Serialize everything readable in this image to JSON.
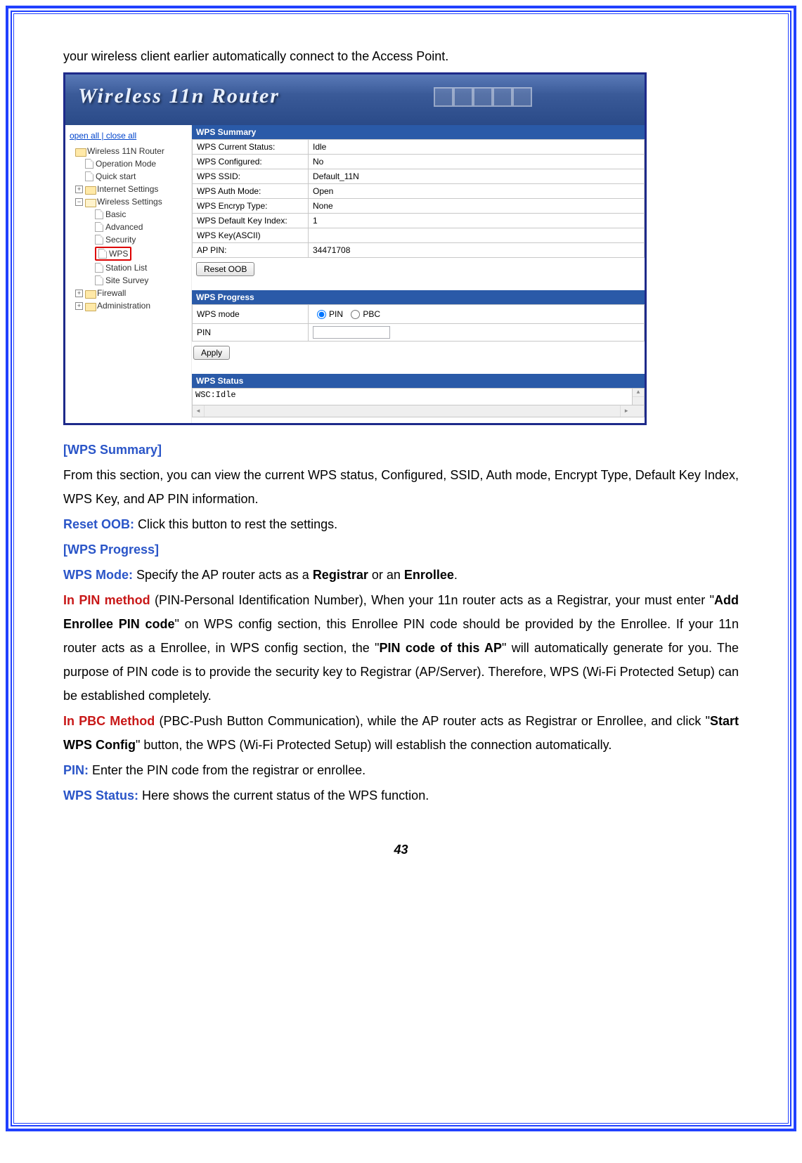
{
  "intro": "your wireless client earlier automatically connect to the Access Point.",
  "banner_title": "Wireless 11n Router",
  "sidebar": {
    "top_links": "open all | close all",
    "root": "Wireless 11N Router",
    "operation_mode": "Operation Mode",
    "quick_start": "Quick start",
    "internet_settings": "Internet Settings",
    "wireless_settings": "Wireless Settings",
    "basic": "Basic",
    "advanced": "Advanced",
    "security": "Security",
    "wps": "WPS",
    "station_list": "Station List",
    "site_survey": "Site Survey",
    "firewall": "Firewall",
    "administration": "Administration"
  },
  "summary": {
    "header": "WPS Summary",
    "rows": [
      [
        "WPS Current Status:",
        "Idle"
      ],
      [
        "WPS Configured:",
        "No"
      ],
      [
        "WPS SSID:",
        "Default_11N"
      ],
      [
        "WPS Auth Mode:",
        "Open"
      ],
      [
        "WPS Encryp Type:",
        "None"
      ],
      [
        "WPS Default Key Index:",
        "1"
      ],
      [
        "WPS Key(ASCII)",
        ""
      ],
      [
        "AP PIN:",
        "34471708"
      ]
    ],
    "reset_button": "Reset OOB"
  },
  "progress": {
    "header": "WPS Progress",
    "mode_label": "WPS mode",
    "pin_radio": "PIN",
    "pbc_radio": "PBC",
    "pin_label": "PIN",
    "apply_button": "Apply"
  },
  "status": {
    "header": "WPS Status",
    "text": "WSC:Idle"
  },
  "doc": {
    "sec1_title": "[WPS Summary]",
    "sec1_p1": "From this section, you can view the current WPS status, Configured, SSID, Auth mode, Encrypt Type, Default Key Index, WPS Key, and AP PIN information.",
    "reset_oob_label": "Reset OOB:",
    "reset_oob_text": " Click this button to rest the settings.",
    "sec2_title": "[WPS Progress]",
    "wps_mode_label": "WPS Mode:",
    "wps_mode_text_a": " Specify the AP router acts as a ",
    "registrar": "Registrar",
    "wps_mode_text_b": " or an ",
    "enrollee": "Enrollee",
    "period": ".",
    "pin_method_label": "In PIN method",
    "pin_method_text_a": " (PIN-Personal Identification Number), When your 11n router acts as a Registrar, your must enter \"",
    "add_enrollee": "Add Enrollee PIN code",
    "pin_method_text_b": "\" on WPS config section, this Enrollee PIN code should be provided by the Enrollee. If your 11n router acts as a Enrollee, in WPS config section, the \"",
    "pin_code_ap": "PIN code of this AP",
    "pin_method_text_c": "\" will automatically generate for you. The purpose of PIN code is to provide the security key to Registrar (AP/Server). Therefore, WPS (Wi-Fi Protected Setup) can be established completely.",
    "pbc_method_label": "In PBC Method",
    "pbc_method_text_a": " (PBC-Push Button Communication), while the AP router acts as Registrar or Enrollee, and click \"",
    "start_wps": "Start WPS Config",
    "pbc_method_text_b": "\" button, the WPS (Wi-Fi Protected Setup) will establish the connection automatically.",
    "pin_label2": "PIN:",
    "pin_text": " Enter the PIN code from the registrar or enrollee.",
    "wps_status_label": "WPS Status:",
    "wps_status_text": " Here shows the current status of the WPS function."
  },
  "page_number": "43"
}
